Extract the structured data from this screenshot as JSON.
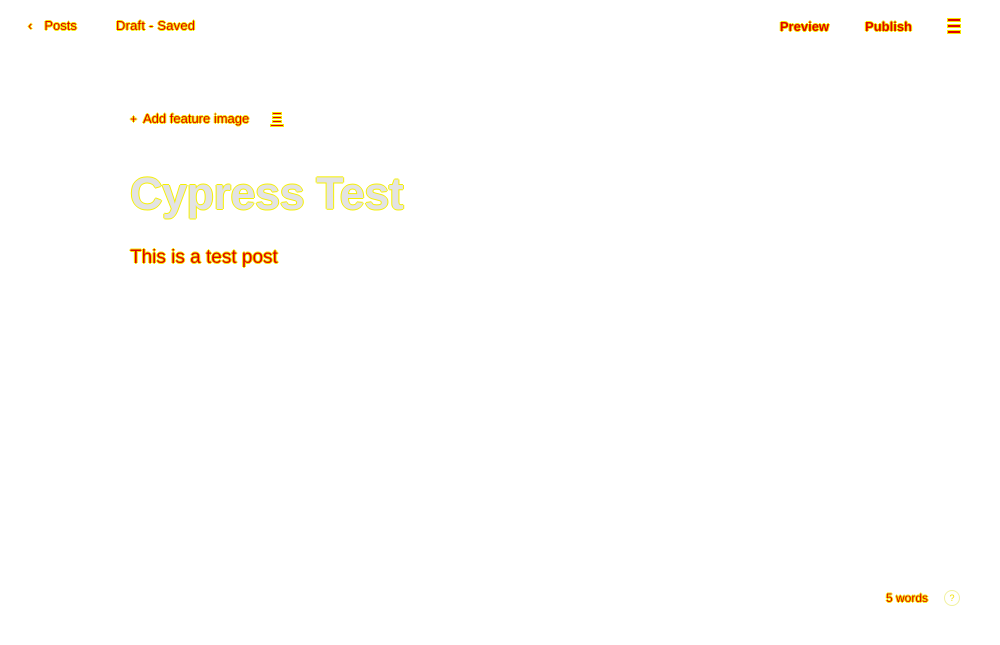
{
  "topbar": {
    "back_chevron": "‹",
    "back_label": "Posts",
    "status": "Draft - Saved",
    "preview_label": "Preview",
    "publish_label": "Publish",
    "menu_icon": "menu-icon"
  },
  "editor": {
    "feature_plus": "+",
    "feature_label": "Add feature image",
    "post_title": "Cypress Test",
    "post_body": "This is a test post"
  },
  "footer": {
    "word_count": "5 words",
    "help_icon": "?"
  },
  "colors": {
    "text_red": "#e00000",
    "outline_yellow": "#f3e800",
    "title_gray": "#e3e3e3",
    "background": "#ffffff"
  }
}
